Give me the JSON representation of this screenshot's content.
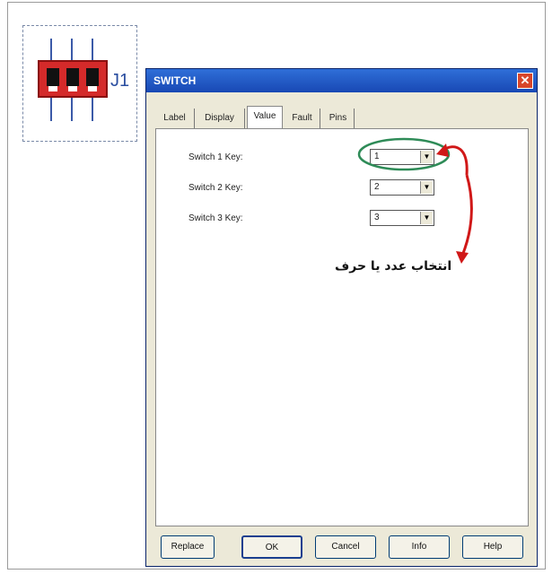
{
  "component": {
    "reference": "J1",
    "switch_count": 3
  },
  "dialog": {
    "title": "SWITCH",
    "close_icon": "close-icon",
    "tabs": [
      {
        "label": "Label",
        "active": false
      },
      {
        "label": "Display",
        "active": false
      },
      {
        "label": "Value",
        "active": true
      },
      {
        "label": "Fault",
        "active": false
      },
      {
        "label": "Pins",
        "active": false
      }
    ],
    "fields": [
      {
        "label": "Switch 1 Key:",
        "value": "1"
      },
      {
        "label": "Switch 2 Key:",
        "value": "2"
      },
      {
        "label": "Switch 3 Key:",
        "value": "3"
      }
    ],
    "buttons": {
      "replace": "Replace",
      "ok": "OK",
      "cancel": "Cancel",
      "info": "Info",
      "help": "Help"
    }
  },
  "annotation": {
    "text": "انتخاب عدد یا حرف",
    "highlight_color": "#2e8b57",
    "arrow_color": "#d01818"
  }
}
